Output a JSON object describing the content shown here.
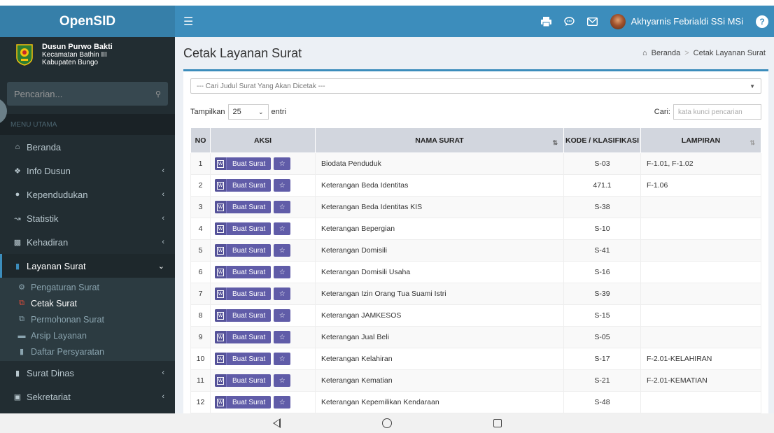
{
  "app": {
    "name": "OpenSID"
  },
  "header": {
    "username": "Akhyarnis Febrialdi SSi MSi",
    "icons": [
      "print-icon",
      "chat-icon",
      "mail-icon",
      "help-icon"
    ]
  },
  "sidebar": {
    "village": {
      "line1": "Dusun Purwo Bakti",
      "line2": "Kecamatan Bathin III",
      "line3": "Kabupaten Bungo"
    },
    "search_placeholder": "Pencarian...",
    "menu_header": "MENU UTAMA",
    "items": [
      {
        "label": "Beranda",
        "icon": "home-icon"
      },
      {
        "label": "Info Dusun",
        "icon": "group-icon"
      },
      {
        "label": "Kependudukan",
        "icon": "users-icon"
      },
      {
        "label": "Statistik",
        "icon": "chart-icon"
      },
      {
        "label": "Kehadiran",
        "icon": "bar-chart-icon"
      },
      {
        "label": "Layanan Surat",
        "icon": "book-icon"
      }
    ],
    "submenu": [
      {
        "label": "Pengaturan Surat",
        "icon": "gear-icon"
      },
      {
        "label": "Cetak Surat",
        "icon": "copy-icon"
      },
      {
        "label": "Permohonan Surat",
        "icon": "copy-icon"
      },
      {
        "label": "Arsip Layanan",
        "icon": "folder-icon"
      },
      {
        "label": "Daftar Persyaratan",
        "icon": "book-icon"
      }
    ],
    "items_after": [
      {
        "label": "Surat Dinas",
        "icon": "book-icon"
      },
      {
        "label": "Sekretariat",
        "icon": "archive-icon"
      }
    ]
  },
  "content": {
    "title": "Cetak Layanan Surat",
    "breadcrumb": {
      "home": "Beranda",
      "current": "Cetak Layanan Surat"
    },
    "select_placeholder": "--- Cari Judul Surat Yang Akan Dicetak ---",
    "show_label": "Tampilkan",
    "length_value": "25",
    "entries_label": "entri",
    "search_label": "Cari:",
    "search_placeholder": "kata kunci pencarian",
    "table": {
      "headers": [
        "NO",
        "AKSI",
        "NAMA SURAT",
        "KODE / KLASIFIKASI",
        "LAMPIRAN"
      ],
      "button_label": "Buat Surat",
      "rows": [
        {
          "no": "1",
          "nama": "Biodata Penduduk",
          "kode": "S-03",
          "lampiran": "F-1.01, F-1.02"
        },
        {
          "no": "2",
          "nama": "Keterangan Beda Identitas",
          "kode": "471.1",
          "lampiran": "F-1.06"
        },
        {
          "no": "3",
          "nama": "Keterangan Beda Identitas KIS",
          "kode": "S-38",
          "lampiran": ""
        },
        {
          "no": "4",
          "nama": "Keterangan Bepergian",
          "kode": "S-10",
          "lampiran": ""
        },
        {
          "no": "5",
          "nama": "Keterangan Domisili",
          "kode": "S-41",
          "lampiran": ""
        },
        {
          "no": "6",
          "nama": "Keterangan Domisili Usaha",
          "kode": "S-16",
          "lampiran": ""
        },
        {
          "no": "7",
          "nama": "Keterangan Izin Orang Tua Suami Istri",
          "kode": "S-39",
          "lampiran": ""
        },
        {
          "no": "8",
          "nama": "Keterangan JAMKESOS",
          "kode": "S-15",
          "lampiran": ""
        },
        {
          "no": "9",
          "nama": "Keterangan Jual Beli",
          "kode": "S-05",
          "lampiran": ""
        },
        {
          "no": "10",
          "nama": "Keterangan Kelahiran",
          "kode": "S-17",
          "lampiran": "F-2.01-KELAHIRAN"
        },
        {
          "no": "11",
          "nama": "Keterangan Kematian",
          "kode": "S-21",
          "lampiran": "F-2.01-KEMATIAN"
        },
        {
          "no": "12",
          "nama": "Keterangan Kepemilikan Kendaraan",
          "kode": "S-48",
          "lampiran": ""
        }
      ]
    }
  },
  "colors": {
    "primary": "#3c8dbc",
    "logo_bg": "#367fa9",
    "sidebar_bg": "#222d32",
    "button": "#605ca8"
  }
}
